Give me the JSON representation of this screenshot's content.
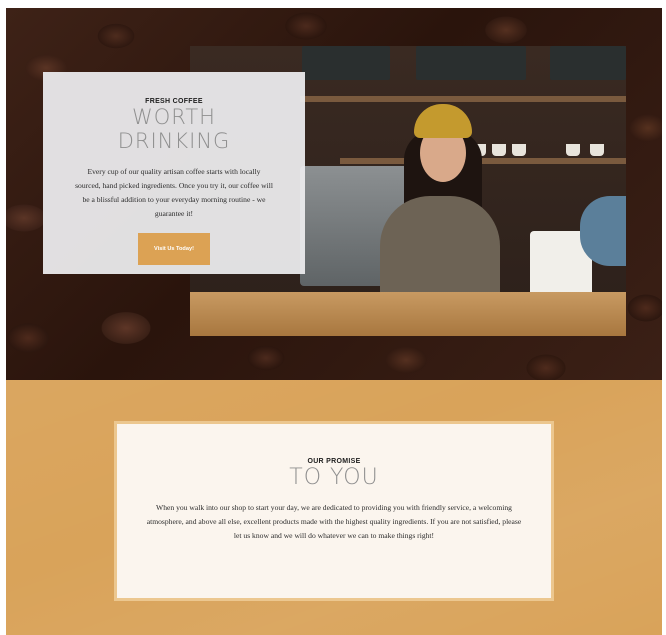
{
  "hero": {
    "eyebrow": "FRESH COFFEE",
    "title_line1": "WORTH",
    "title_line2": "DRINKING",
    "body": "Every cup of our quality artisan coffee starts with locally sourced, hand picked ingredients. Once you try it, our coffee will be a blissful addition to your everyday morning routine - we guarantee it!",
    "cta_label": "Visit Us Today!"
  },
  "promise": {
    "eyebrow": "OUR PROMISE",
    "title": "TO YOU",
    "body": "When you walk into our shop to start your day, we are dedicated to providing you with friendly service, a welcoming atmosphere, and above all else, excellent products made with the highest quality ingredients. If you are not satisfied, please let us know and we will do whatever we can to make things right!"
  },
  "colors": {
    "accent": "#dca254",
    "section_bg": "#d9a35a",
    "hero_bg": "#3a2016",
    "card_bg": "#fbf5ee",
    "title_gray": "#8f8f8f"
  }
}
